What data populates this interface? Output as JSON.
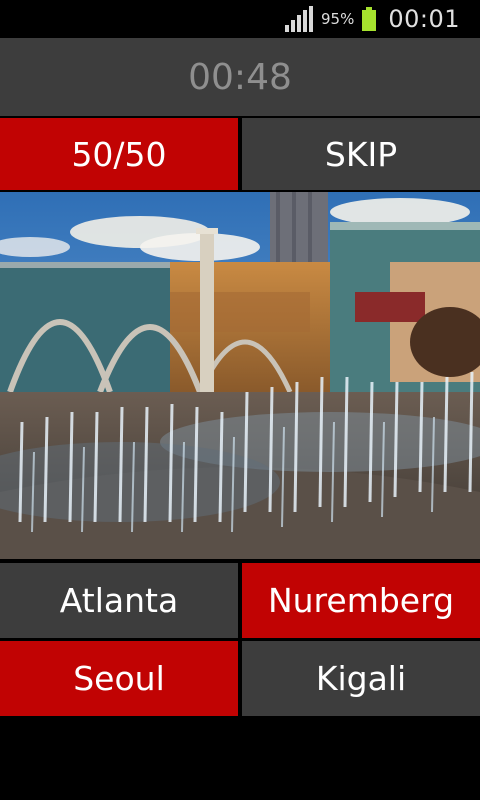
{
  "status": {
    "battery": "95%",
    "time": "00:01"
  },
  "timer": "00:48",
  "lifelines": {
    "fifty_fifty": "50/50",
    "skip": "SKIP"
  },
  "answers": [
    "Atlanta",
    "Nuremberg",
    "Seoul",
    "Kigali"
  ],
  "colors": {
    "red": "#c10303",
    "gray": "#3d3d3d",
    "battery": "#a6e22e"
  }
}
